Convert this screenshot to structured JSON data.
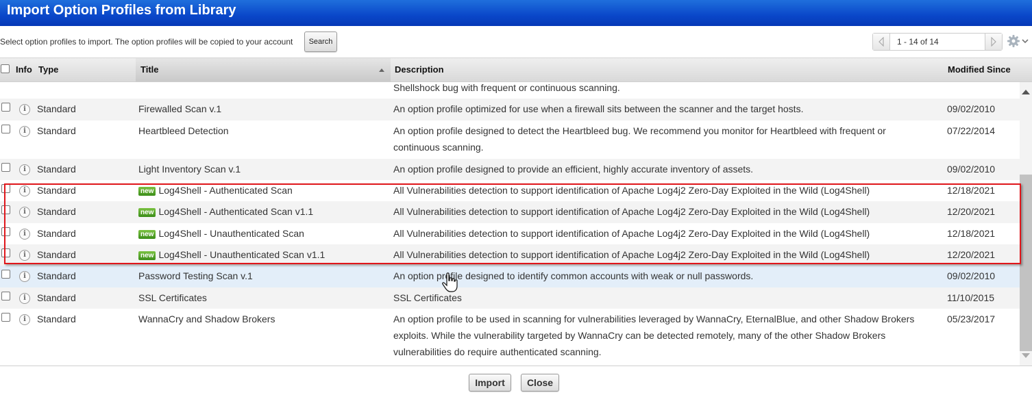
{
  "window": {
    "title": "Import Option Profiles from Library"
  },
  "toolbar": {
    "hint": "Select option profiles to import. The option profiles will be copied to your account",
    "search_label": "Search",
    "pager_range": "1 - 14 of 14"
  },
  "columns": {
    "info": "Info",
    "type": "Type",
    "title": "Title",
    "description": "Description",
    "modified": "Modified Since"
  },
  "partial_row": {
    "description": "Shellshock bug with frequent or continuous scanning."
  },
  "rows": [
    {
      "type": "Standard",
      "badge": "",
      "title": "Firewalled Scan v.1",
      "description": "An option profile optimized for use when a firewall sits between the scanner and the target hosts.",
      "modified": "09/02/2010"
    },
    {
      "type": "Standard",
      "badge": "",
      "title": "Heartbleed Detection",
      "description": "An option profile designed to detect the Heartbleed bug. We recommend you monitor for Heartbleed with frequent or continuous scanning.",
      "modified": "07/22/2014"
    },
    {
      "type": "Standard",
      "badge": "",
      "title": "Light Inventory Scan v.1",
      "description": "An option profile designed to provide an efficient, highly accurate inventory of assets.",
      "modified": "09/02/2010"
    },
    {
      "type": "Standard",
      "badge": "new",
      "title": "Log4Shell - Authenticated Scan",
      "description": "All Vulnerabilities detection to support identification of Apache Log4j2 Zero-Day Exploited in the Wild (Log4Shell)",
      "modified": "12/18/2021"
    },
    {
      "type": "Standard",
      "badge": "new",
      "title": "Log4Shell - Authenticated Scan v1.1",
      "description": "All Vulnerabilities detection to support identification of Apache Log4j2 Zero-Day Exploited in the Wild (Log4Shell)",
      "modified": "12/20/2021"
    },
    {
      "type": "Standard",
      "badge": "new",
      "title": "Log4Shell - Unauthenticated Scan",
      "description": "All Vulnerabilities detection to support identification of Apache Log4j2 Zero-Day Exploited in the Wild (Log4Shell)",
      "modified": "12/18/2021"
    },
    {
      "type": "Standard",
      "badge": "new",
      "title": "Log4Shell - Unauthenticated Scan v1.1",
      "description": "All Vulnerabilities detection to support identification of Apache Log4j2 Zero-Day Exploited in the Wild (Log4Shell)",
      "modified": "12/20/2021"
    },
    {
      "type": "Standard",
      "badge": "",
      "title": "Password Testing Scan v.1",
      "description": "An option profile designed to identify common accounts with weak or null passwords.",
      "modified": "09/02/2010"
    },
    {
      "type": "Standard",
      "badge": "",
      "title": "SSL Certificates",
      "description": "SSL Certificates",
      "modified": "11/10/2015"
    },
    {
      "type": "Standard",
      "badge": "",
      "title": "WannaCry and Shadow Brokers",
      "description": "An option profile to be used in scanning for vulnerabilities leveraged by WannaCry, EternalBlue, and other Shadow Brokers exploits. While the vulnerability targeted by WannaCry can be detected remotely, many of the other Shadow Brokers vulnerabilities do require authenticated scanning.",
      "modified": "05/23/2017"
    }
  ],
  "info_glyph": "i",
  "footer": {
    "import_label": "Import",
    "close_label": "Close"
  },
  "colors": {
    "title_bar": "#0a47c9",
    "highlight_border": "#e0161b",
    "new_badge": "#4a9e1f",
    "hover_row": "#e3eef9"
  }
}
